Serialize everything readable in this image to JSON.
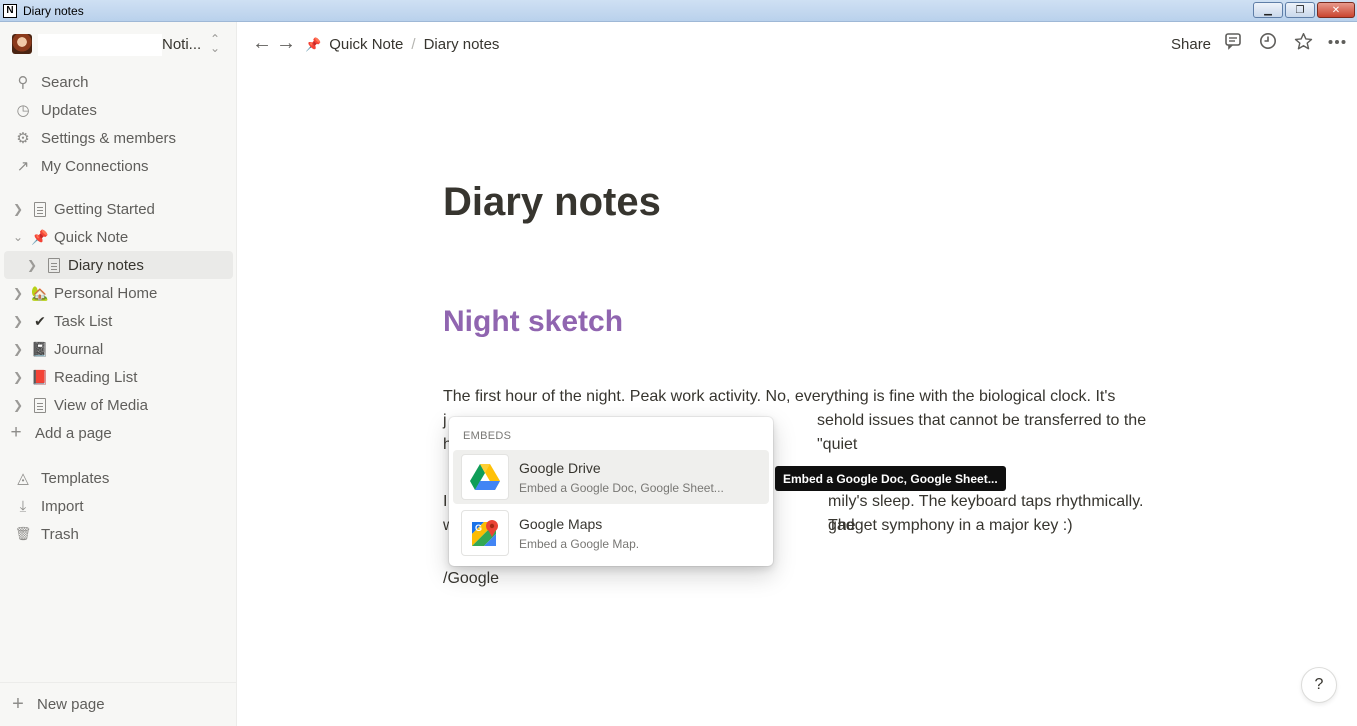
{
  "window": {
    "title": "Diary notes",
    "app_icon": "N"
  },
  "workspace": {
    "name": "Noti..."
  },
  "sidebar": {
    "nav": [
      {
        "label": "Search",
        "icon": "search-icon",
        "glyph": "⚲"
      },
      {
        "label": "Updates",
        "icon": "clock-icon",
        "glyph": "◷"
      },
      {
        "label": "Settings & members",
        "icon": "gear-icon",
        "glyph": "⚙"
      },
      {
        "label": "My Connections",
        "icon": "external-link-icon",
        "glyph": "↗"
      }
    ],
    "pages": [
      {
        "label": "Getting Started",
        "icon": "document-icon"
      },
      {
        "label": "Quick Note",
        "icon": "pushpin-icon",
        "glyph": "📌",
        "expanded": true
      },
      {
        "label": "Diary notes",
        "icon": "document-icon",
        "active": true
      },
      {
        "label": "Personal Home",
        "icon": "house-icon",
        "glyph": "🏡"
      },
      {
        "label": "Task List",
        "icon": "checkmark-icon",
        "glyph": "✔"
      },
      {
        "label": "Journal",
        "icon": "notebook-icon",
        "glyph": "📓"
      },
      {
        "label": "Reading List",
        "icon": "book-icon",
        "glyph": "📕"
      },
      {
        "label": "View of Media",
        "icon": "document-edit-icon"
      }
    ],
    "add_page": "Add a page",
    "tools": [
      {
        "label": "Templates",
        "icon": "templates-icon",
        "glyph": "◬"
      },
      {
        "label": "Import",
        "icon": "download-icon",
        "glyph": "⤓"
      },
      {
        "label": "Trash",
        "icon": "trash-icon",
        "glyph": "🗑"
      }
    ],
    "new_page": "New page"
  },
  "topbar": {
    "breadcrumb": [
      "Quick Note",
      "Diary notes"
    ],
    "separator": "/",
    "share": "Share"
  },
  "page": {
    "title": "Diary notes",
    "heading": "Night sketch",
    "para1": "The first hour of the night. Peak work activity. No, everything is fine with the biological clock. It's just that during the day I solve routine household issues that cannot be transferred to the \"quiet hours\".",
    "para2": "I am grateful for the silence, the family's sleep. The keyboard taps rhythmically. The whirring of the laptop. A kind of gadget symphony in a major key :)",
    "para1_visible_a": "The first hour of the night. Peak work activity. No, everything is fine with the biological clock. It's",
    "para1_visible_b": "j",
    "para1_visible_c": "sehold issues that cannot be transferred to the \"quiet",
    "para1_visible_d": "h",
    "para2_visible_a": "I",
    "para2_visible_b": "mily's sleep. The keyboard taps rhythmically. The",
    "para2_visible_c": "w",
    "para2_visible_d": "gadget symphony in a major key :)",
    "slash_command": "/Google"
  },
  "popup": {
    "section_label": "EMBEDS",
    "options": [
      {
        "name": "Google Drive",
        "desc": "Embed a Google Doc, Google Sheet...",
        "icon": "google-drive-icon"
      },
      {
        "name": "Google Maps",
        "desc": "Embed a Google Map.",
        "icon": "google-maps-icon"
      }
    ]
  },
  "tooltip": "Embed a Google Doc, Google Sheet...",
  "help": "?"
}
